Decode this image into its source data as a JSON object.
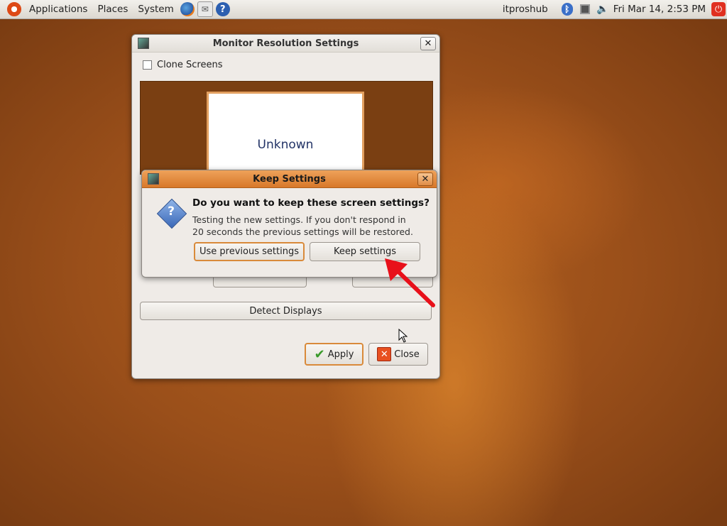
{
  "panel": {
    "menus": [
      "Applications",
      "Places",
      "System"
    ],
    "user": "itproshub",
    "clock": "Fri Mar 14,  2:53 PM"
  },
  "main_window": {
    "title": "Monitor Resolution Settings",
    "close_glyph": "✕",
    "clone_screens_label": "Clone Screens",
    "monitor_label": "Unknown",
    "detect_displays_label": "Detect Displays",
    "apply_label": "Apply",
    "close_label": "Close"
  },
  "dialog": {
    "title": "Keep Settings",
    "close_glyph": "✕",
    "heading": "Do you want to keep these screen settings?",
    "message_line1": "Testing the new settings. If you don't respond in",
    "message_line2": "20 seconds the previous settings will be restored.",
    "use_previous_label": "Use previous settings",
    "keep_label": "Keep settings"
  },
  "colors": {
    "accent_orange": "#d98a3a",
    "arrow_red": "#e8101a"
  }
}
